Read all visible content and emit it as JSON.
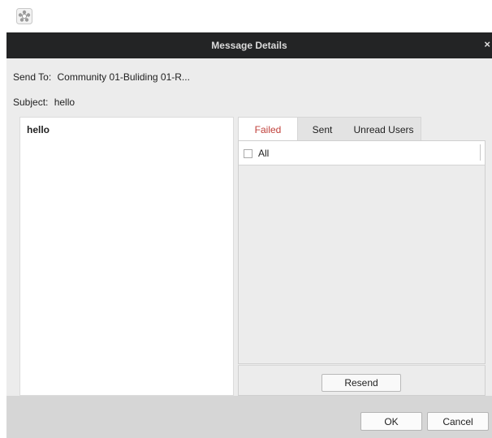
{
  "app": {
    "icon": "gear-logo-icon"
  },
  "dialog": {
    "title": "Message Details",
    "close_glyph": "×",
    "send_to": {
      "label": "Send To:",
      "value": "Community 01-Buliding 01-R..."
    },
    "subject": {
      "label": "Subject:",
      "value": "hello"
    },
    "message_body": "hello",
    "tabs": [
      {
        "label": "Failed",
        "active": true
      },
      {
        "label": "Sent",
        "active": false
      },
      {
        "label": "Unread Users",
        "active": false
      }
    ],
    "list": {
      "select_all_label": "All",
      "checked": false
    },
    "buttons": {
      "resend": "Resend",
      "ok": "OK",
      "cancel": "Cancel"
    }
  },
  "colors": {
    "titlebar_bg": "#232425",
    "active_tab_text": "#c0413b",
    "dialog_bg": "#ececec",
    "footer_bg": "#d6d6d6"
  }
}
